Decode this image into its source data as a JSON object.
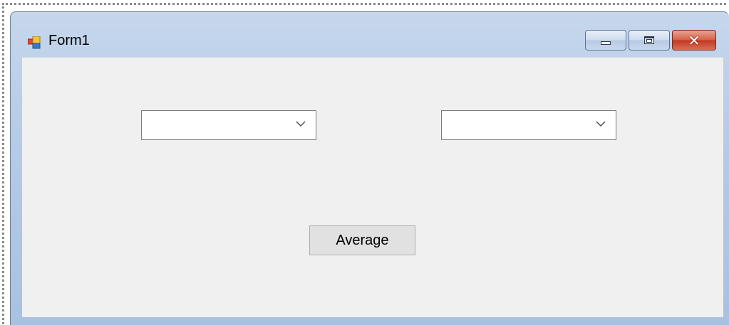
{
  "window": {
    "title": "Form1",
    "icon": "winforms-app-icon",
    "caption_buttons": [
      "minimize-icon",
      "maximize-icon",
      "close-icon"
    ]
  },
  "form": {
    "combo_left": {
      "value": "",
      "icon": "chevron-down-icon"
    },
    "combo_right": {
      "value": "",
      "icon": "chevron-down-icon"
    },
    "average_button": {
      "label": "Average"
    }
  },
  "colors": {
    "client_background": "#f0f0f0",
    "titlebar": "#b9cde8",
    "close_button": "#c8432a"
  }
}
